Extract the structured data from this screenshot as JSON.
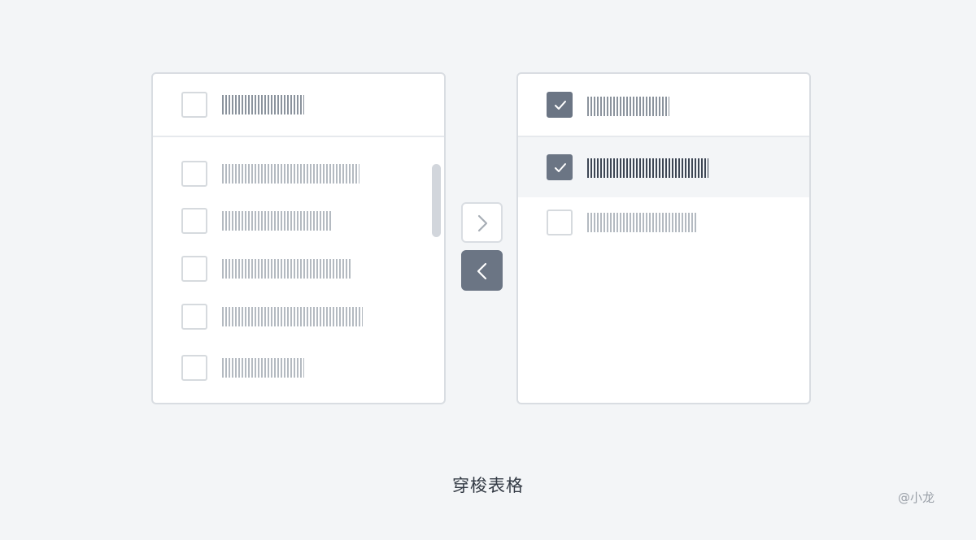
{
  "left_panel": {
    "header": {
      "select_all_checked": false
    },
    "items": [
      {
        "checked": false
      },
      {
        "checked": false
      },
      {
        "checked": false
      },
      {
        "checked": false
      },
      {
        "checked": false
      }
    ]
  },
  "right_panel": {
    "header": {
      "select_all_checked": true
    },
    "items": [
      {
        "checked": true,
        "highlighted": true
      },
      {
        "checked": false,
        "highlighted": false
      }
    ]
  },
  "buttons": {
    "move_right_icon": "chevron-right-icon",
    "move_left_icon": "chevron-left-icon"
  },
  "caption": "穿梭表格",
  "watermark": "@小龙",
  "colors": {
    "background": "#f3f5f7",
    "accent": "#6b7584",
    "border": "#d9dde2",
    "placeholder_text": "#b4bac1",
    "placeholder_header": "#8b939d",
    "placeholder_dark": "#3d4654",
    "scrollbar": "#d2d6dc"
  }
}
